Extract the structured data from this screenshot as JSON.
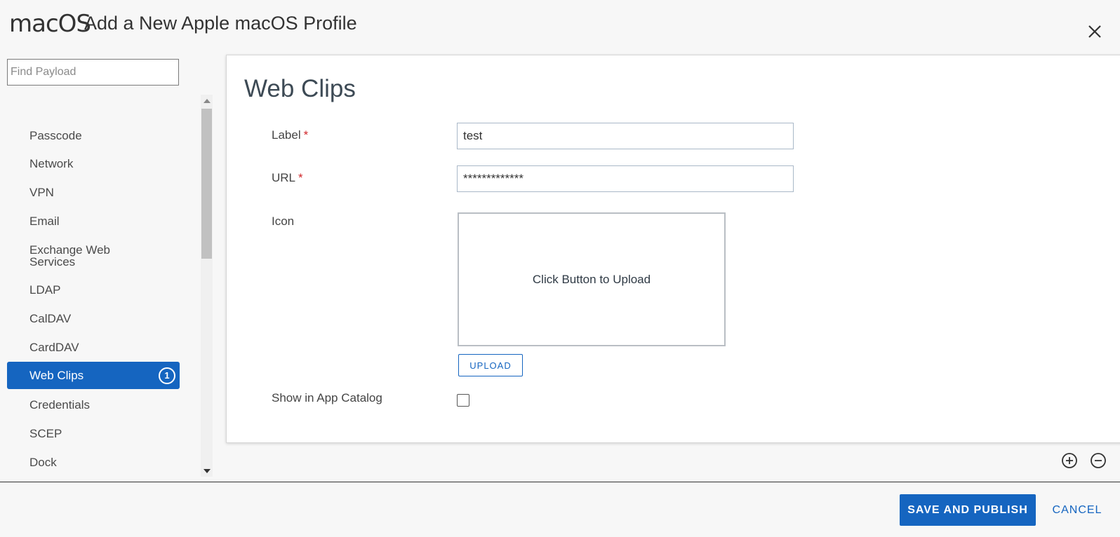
{
  "header": {
    "brand": "macOS",
    "title": "Add a New Apple macOS Profile",
    "close_icon": "close-icon"
  },
  "sidebar": {
    "search_placeholder": "Find Payload",
    "items": [
      {
        "label": "Passcode"
      },
      {
        "label": "Network"
      },
      {
        "label": "VPN"
      },
      {
        "label": "Email"
      },
      {
        "label": "Exchange Web Services"
      },
      {
        "label": "LDAP"
      },
      {
        "label": "CalDAV"
      },
      {
        "label": "CardDAV"
      },
      {
        "label": "Web Clips",
        "active": true,
        "badge": "1"
      },
      {
        "label": "Credentials"
      },
      {
        "label": "SCEP"
      },
      {
        "label": "Dock"
      }
    ],
    "exchange_line1": "Exchange Web",
    "exchange_line2": "Services"
  },
  "main": {
    "title": "Web Clips",
    "fields": {
      "label": {
        "label": "Label",
        "required_mark": "*",
        "value": "test"
      },
      "url": {
        "label": "URL",
        "required_mark": "*",
        "value": "*************"
      },
      "icon": {
        "label": "Icon",
        "upload_prompt": "Click Button to Upload",
        "upload_button": "UPLOAD"
      },
      "show_in_catalog": {
        "label": "Show in App Catalog",
        "checked": false
      }
    }
  },
  "controls": {
    "add_icon": "plus-circle-icon",
    "remove_icon": "minus-circle-icon"
  },
  "footer": {
    "save_label": "SAVE AND PUBLISH",
    "cancel_label": "CANCEL"
  },
  "colors": {
    "accent": "#1565c0",
    "required": "#d0262a"
  }
}
